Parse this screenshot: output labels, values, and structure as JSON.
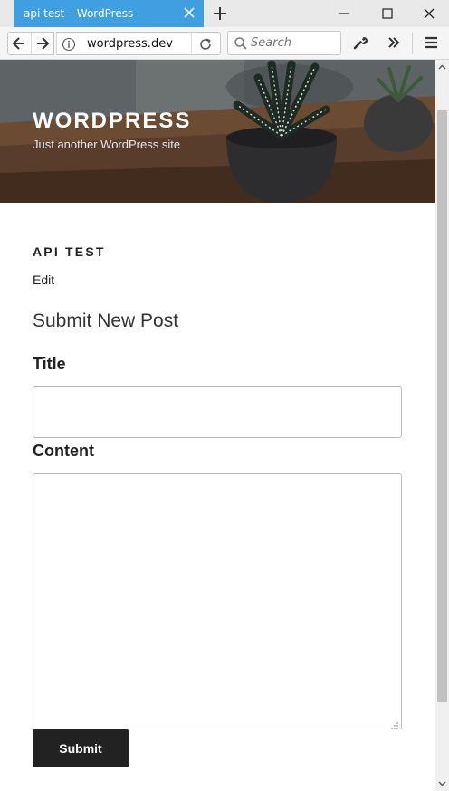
{
  "browser": {
    "tab_title": "api test – WordPress",
    "url": "wordpress.dev",
    "search_placeholder": "Search",
    "accent_color": "#3f9fe0"
  },
  "header": {
    "site_title": "WORDPRESS",
    "site_description": "Just another WordPress site"
  },
  "page": {
    "title": "API TEST",
    "edit_link": "Edit"
  },
  "form": {
    "heading": "Submit New Post",
    "title_label": "Title",
    "title_value": "",
    "content_label": "Content",
    "content_value": "",
    "submit_label": "Submit"
  },
  "icons": {
    "tab_close": "close-icon",
    "new_tab": "plus-icon",
    "back": "arrow-left-icon",
    "forward": "arrow-right-icon",
    "info": "info-icon",
    "reload": "reload-icon",
    "search": "search-icon",
    "tools": "wrench-icon",
    "overflow": "double-chevron-icon",
    "menu": "hamburger-icon"
  }
}
